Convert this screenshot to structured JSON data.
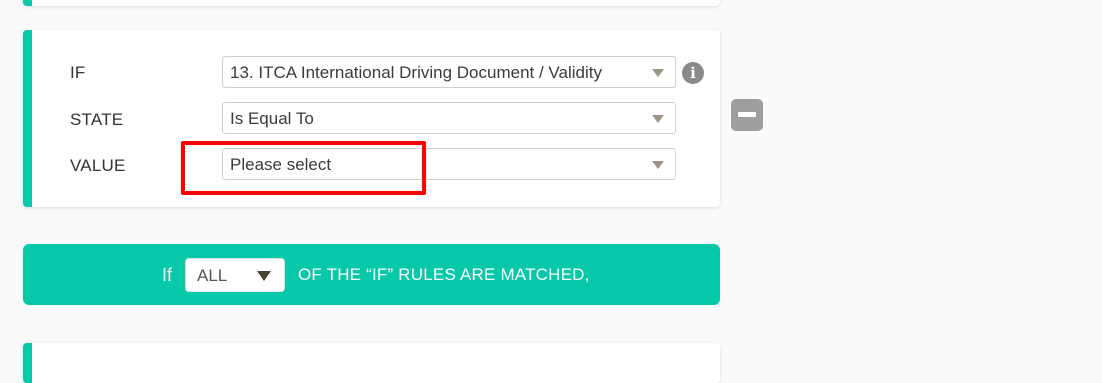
{
  "condition": {
    "rows": [
      {
        "label": "IF",
        "value": "13. ITCA International Driving Document / Validity"
      },
      {
        "label": "STATE",
        "value": "Is Equal To"
      },
      {
        "label": "VALUE",
        "value": "Please select"
      }
    ],
    "info_icon_glyph": "i"
  },
  "match_bar": {
    "prefix": "If",
    "selected": "ALL",
    "suffix": "OF THE “IF” RULES ARE MATCHED,"
  },
  "colors": {
    "accent": "#07c8a8",
    "highlight": "#ff0000",
    "remove_button": "#9e9e9e"
  }
}
